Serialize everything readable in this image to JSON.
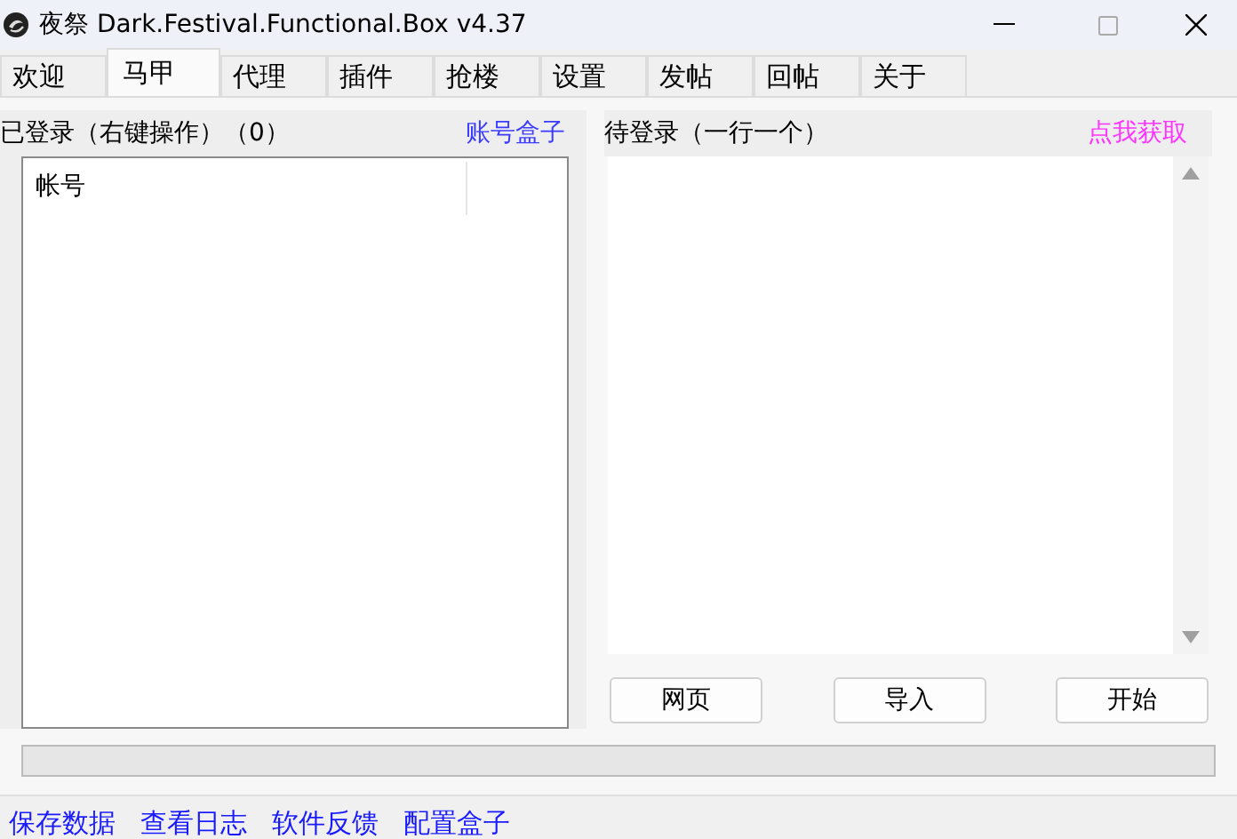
{
  "window": {
    "title": "夜祭 Dark.Festival.Functional.Box v4.37"
  },
  "tabs": [
    {
      "label": "欢迎",
      "selected": false
    },
    {
      "label": "马甲",
      "selected": true
    },
    {
      "label": "代理",
      "selected": false
    },
    {
      "label": "插件",
      "selected": false
    },
    {
      "label": "抢楼",
      "selected": false
    },
    {
      "label": "设置",
      "selected": false
    },
    {
      "label": "发帖",
      "selected": false
    },
    {
      "label": "回帖",
      "selected": false
    },
    {
      "label": "关于",
      "selected": false
    }
  ],
  "logged_in": {
    "label": "已登录（右键操作）（0）",
    "link": "账号盒子",
    "columns": [
      "帐号"
    ]
  },
  "pending": {
    "label": "待登录（一行一个）",
    "link": "点我获取"
  },
  "buttons": [
    "网页",
    "导入",
    "开始"
  ],
  "progress": {
    "level": 0
  },
  "footer_links": [
    "保存数据",
    "查看日志",
    "软件反馈",
    "配置盒子"
  ]
}
